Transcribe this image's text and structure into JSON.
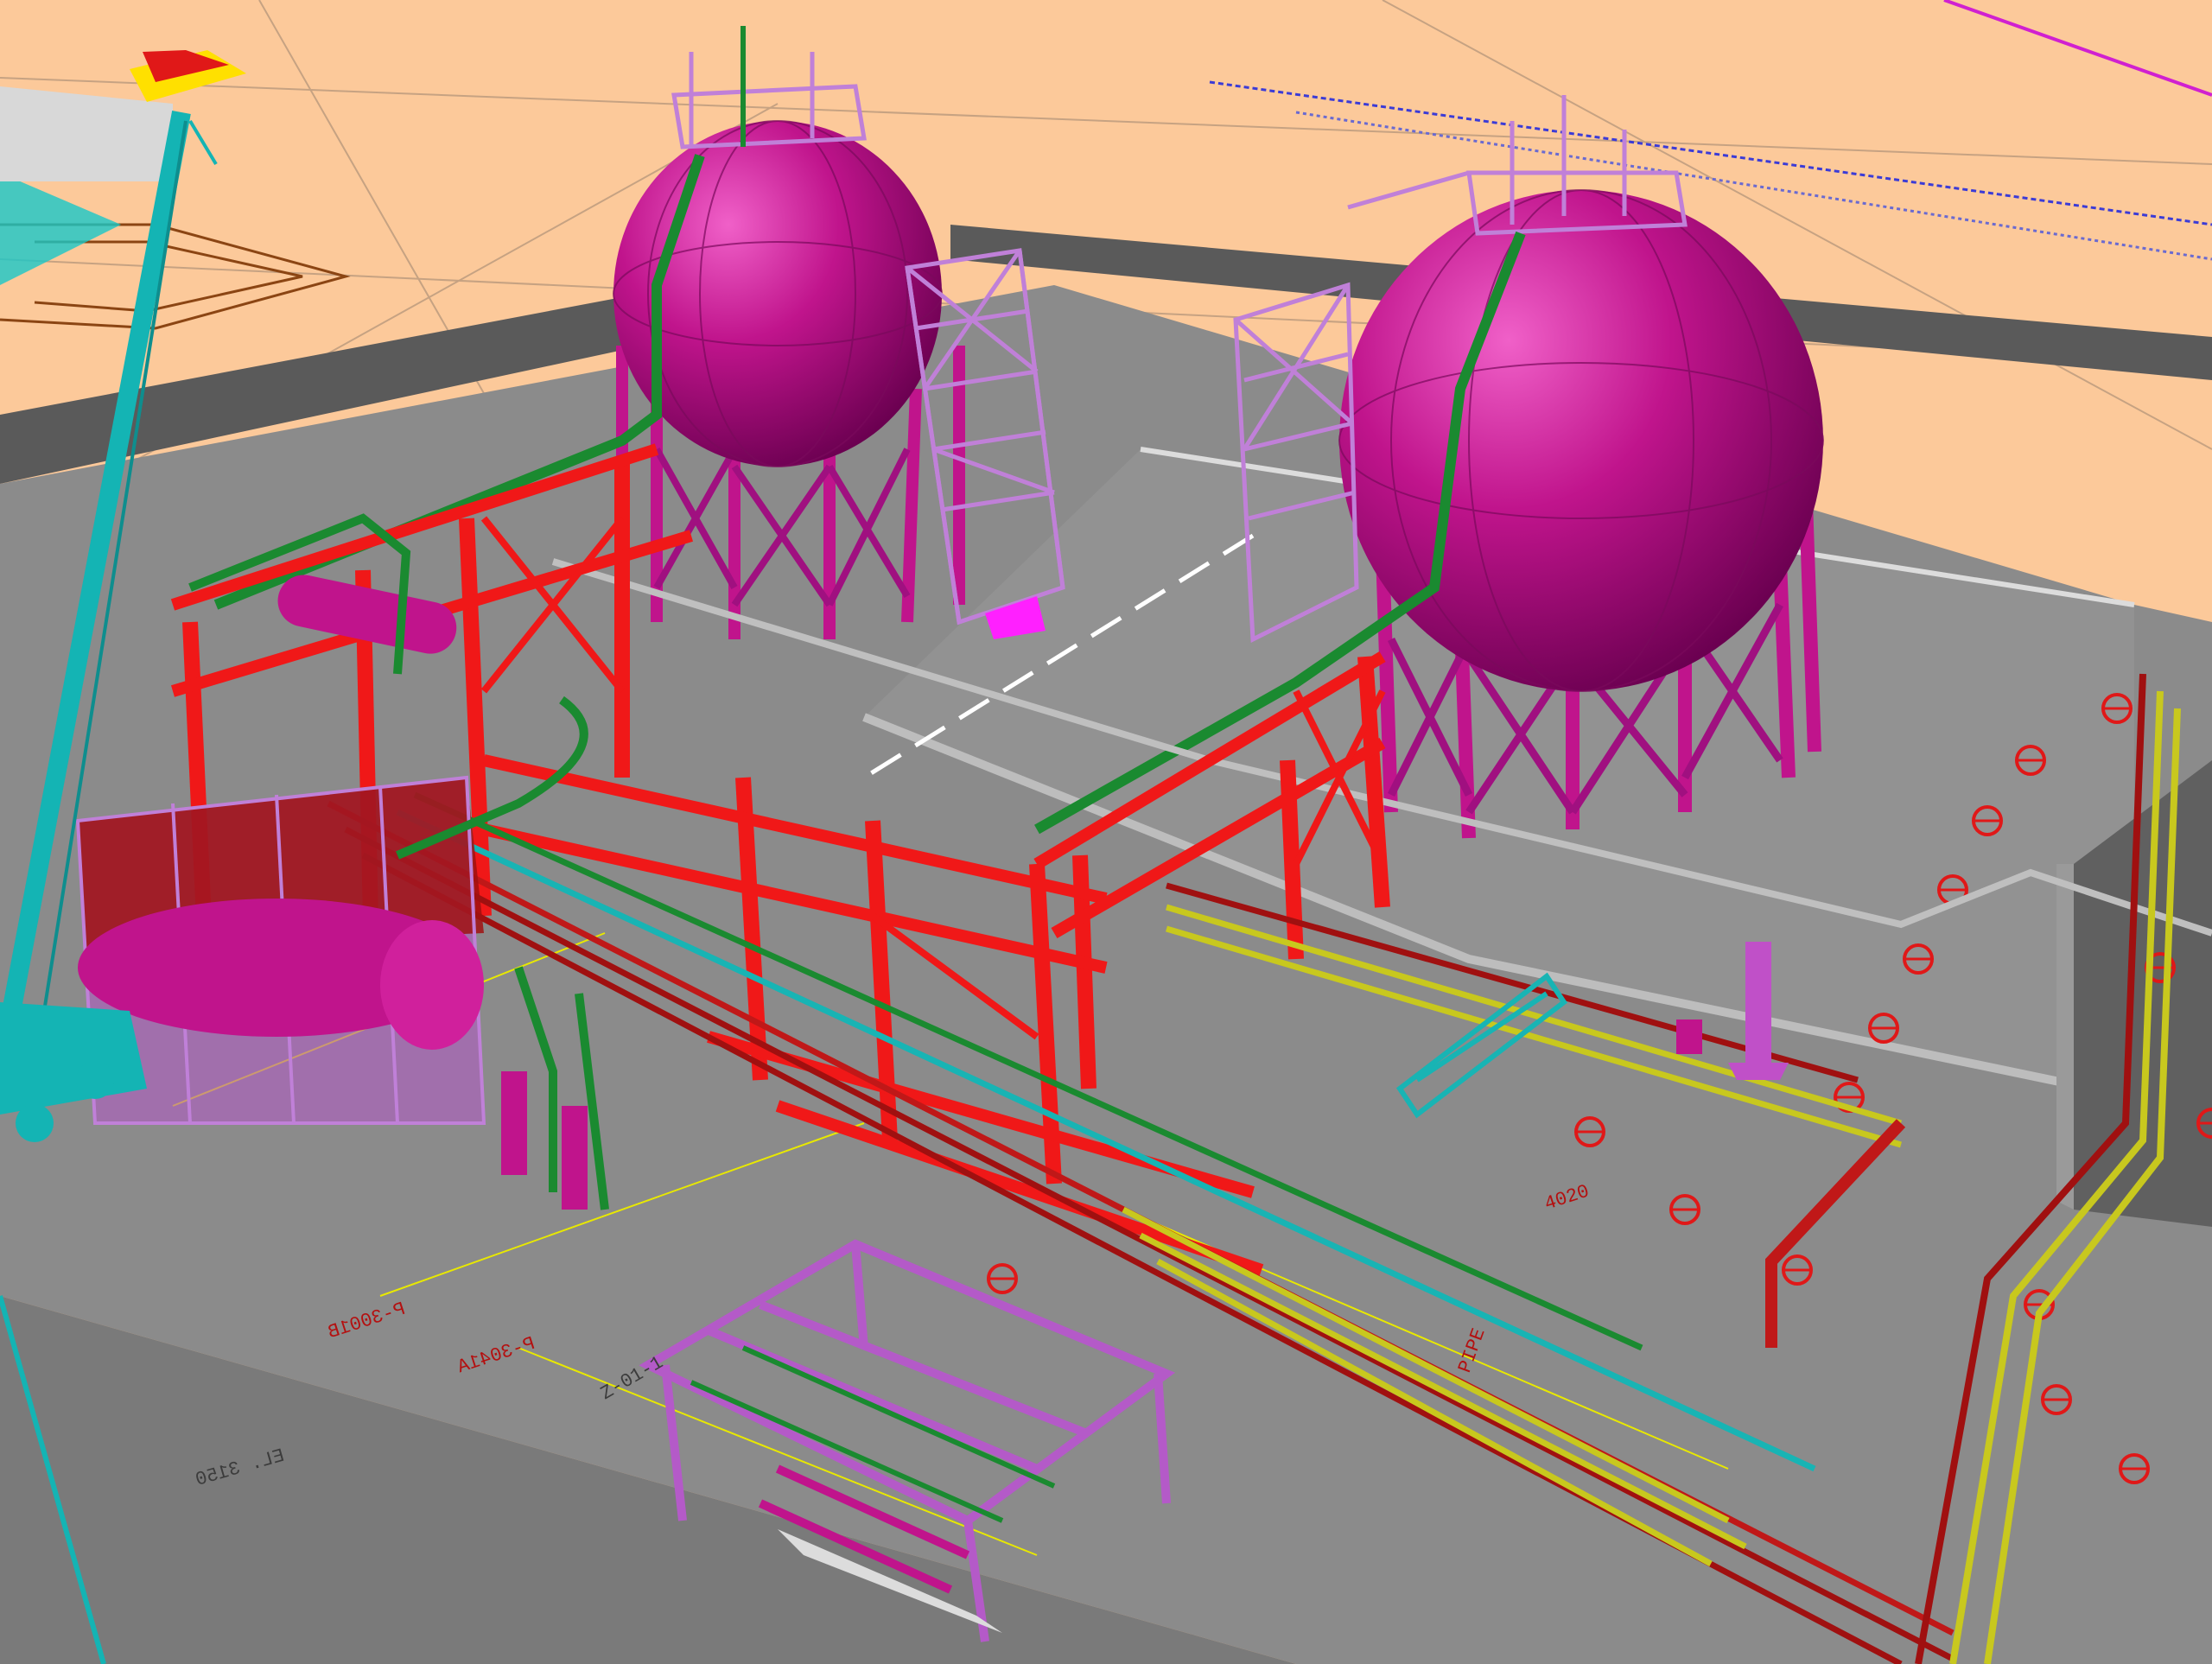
{
  "viewport": {
    "background": "#fcc99a",
    "labels": {
      "tag_p3001b": "P-3001B",
      "tag_p3041a": "P-3041A",
      "tag_z01": "Z-01-1",
      "tag_pipe": "PIPE",
      "tag_dim": "4020",
      "tag_el": "EL. 3150"
    }
  },
  "colors": {
    "ground": "#fcc99a",
    "slab": "#8b8b8b",
    "slab_dark": "#6f6f6f",
    "sphere": "#c0148c",
    "sphere_highlight": "#f060c8",
    "support": "#d0108c",
    "rack_red": "#f01818",
    "pipe_red": "#a01010",
    "pipe_green": "#1a8a30",
    "pipe_yellow": "#c8c81e",
    "pipe_teal": "#18b4b4",
    "structure_purple": "#b45ac8",
    "crane_teal": "#14b4b4",
    "crane_tip": "#ffe000",
    "marker_red": "#e01818"
  }
}
